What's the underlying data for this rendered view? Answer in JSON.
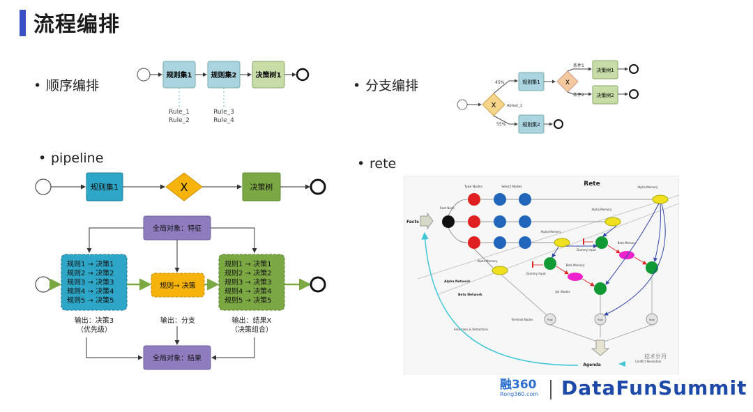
{
  "page": {
    "title": "流程编排"
  },
  "bullets": {
    "sequential": "顺序编排",
    "branch": "分支编排",
    "pipeline": "pipeline",
    "rete": "rete"
  },
  "sequential": {
    "ruleset1": "规则集1",
    "ruleset2": "规则集2",
    "decision_tree": "决策树1",
    "rules_a": [
      "Rule_1",
      "Rule_2"
    ],
    "rules_b": [
      "Rule_3",
      "Rule_4"
    ]
  },
  "branch": {
    "gateway": "X",
    "gateway_label": "Abtest_1",
    "pct_upper": "45%",
    "pct_lower": "55%",
    "ruleset1": "规则集1",
    "ruleset2": "规则集2",
    "gateway2": "X",
    "cond1": "条件1",
    "cond2": "条件2",
    "tree1": "决策树1",
    "tree2": "决策树2"
  },
  "pipeline": {
    "ruleset1": "规则集1",
    "gateway": "X",
    "decision_tree": "决策树",
    "global_in": "全局对象：特征",
    "global_out": "全局对象：结果",
    "left_box": [
      "规则1 → 决策1",
      "规则2 → 决策2",
      "规则3 → 决策3",
      "规则4 → 决策4",
      "规则5 → 决策5"
    ],
    "mid_box": "规则→ 决策",
    "right_box": [
      "规则1 → 决策1",
      "规则2 → 决策2",
      "规则3 → 决策3",
      "规则4 → 决策4",
      "规则5 → 决策5"
    ],
    "out_left": [
      "输出：决策3",
      "（优先级）"
    ],
    "out_mid": "输出：分支",
    "out_right": [
      "输出：结果X",
      "（决策组合）"
    ],
    "colors": {
      "blue": "#2ea6c7",
      "yellow": "#f6b30b",
      "green": "#7ca843",
      "purple": "#8e7cbf"
    }
  },
  "rete": {
    "title": "Rete",
    "facts": "Facts",
    "root_node": "Root Node",
    "type_nodes": "Type Nodes",
    "select_nodes": "Select Nodes",
    "alpha_memory": "Alpha Memory",
    "beta_memory": "Beta Memory",
    "dummy_input": "Dummy Input",
    "alpha_network": "Alpha Network",
    "beta_network": "Beta Network",
    "join_nodes": "Join Nodes",
    "terminal_nodes": "Terminal Nodes",
    "rule": "Rule",
    "assertions": "Assertions & Retractions",
    "agenda": "Agenda",
    "conflict": "Conflict Resolution",
    "watermark": "技术岁月"
  },
  "footer": {
    "logo_cn": "融360",
    "logo_sub": "Rong360.com",
    "brand": "DataFunSummit"
  }
}
